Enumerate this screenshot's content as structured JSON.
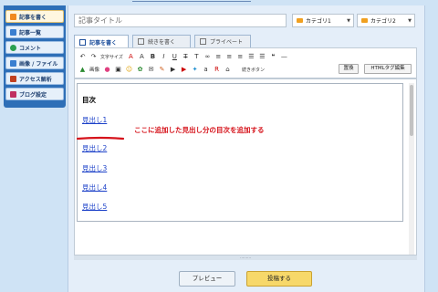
{
  "sidebar": {
    "items": [
      {
        "label": "記事を書く",
        "icon": "pencil-icon",
        "color": "#f08a20"
      },
      {
        "label": "記事一覧",
        "icon": "list-icon",
        "color": "#3a7fd0"
      },
      {
        "label": "コメント",
        "icon": "comment-icon",
        "color": "#2aa050"
      },
      {
        "label": "画像 / ファイル",
        "icon": "image-icon",
        "color": "#3a7fd0"
      },
      {
        "label": "アクセス解析",
        "icon": "analytics-icon",
        "color": "#c04020"
      },
      {
        "label": "ブログ設定",
        "icon": "wrench-icon",
        "color": "#c03060"
      }
    ]
  },
  "editor": {
    "title_placeholder": "記事タイトル",
    "category1": "カテゴリ1",
    "category2": "カテゴリ2",
    "tabs": [
      "記事を書く",
      "続きを書く",
      "プライベート"
    ],
    "toolbar": {
      "text_size": "文字サイズ",
      "omit_button": "続きボタン",
      "replace_button": "置換",
      "html_edit_button": "HTMLタグ編集",
      "image_label": "画像"
    },
    "toc_heading": "目次",
    "toc_links": [
      "見出し1",
      "見出し2",
      "見出し3",
      "見出し4",
      "見出し5"
    ],
    "annotation": "ここに追加した見出し分の目次を追加する"
  },
  "actions": {
    "preview": "プレビュー",
    "post": "投稿する"
  },
  "colors": {
    "sidebar_bg": "#2e6fb7",
    "link": "#1a3fc8",
    "annotation": "#d6141c",
    "post_button": "#f7d86a"
  }
}
